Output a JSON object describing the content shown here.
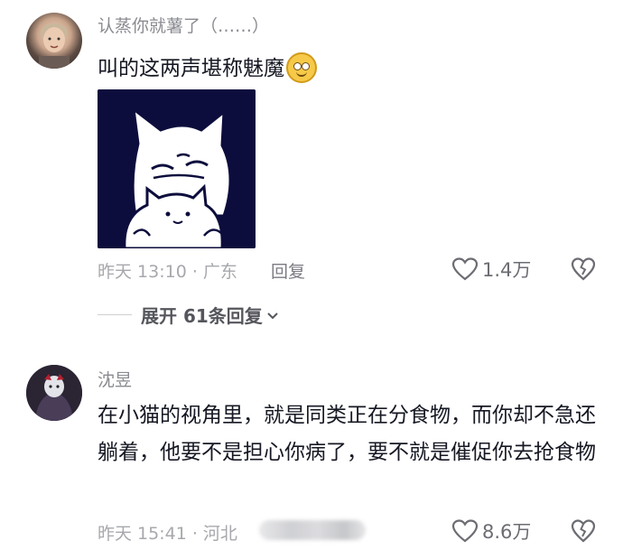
{
  "comments": [
    {
      "username": "认蒸你就薯了（……）",
      "text": "叫的这两声堪称魅魔",
      "time_location": "昨天 13:10 · 广东",
      "reply_label": "回复",
      "likes": "1.4万",
      "expand_label": "展开 61条回复",
      "emoji_icon": "smiling-face-emoji",
      "sticker_icon": "white-cat-sticker"
    },
    {
      "username": "沈昱",
      "text": "在小猫的视角里，就是同类正在分食物，而你却不急还躺着，他要不是担心你病了，要不就是催促你去抢食物",
      "time_location": "昨天 15:41 · 河北",
      "likes": "8.6万"
    }
  ],
  "colors": {
    "text": "#161823",
    "secondary": "#a7a8ad",
    "sticker_bg": "#0d0d3d"
  }
}
